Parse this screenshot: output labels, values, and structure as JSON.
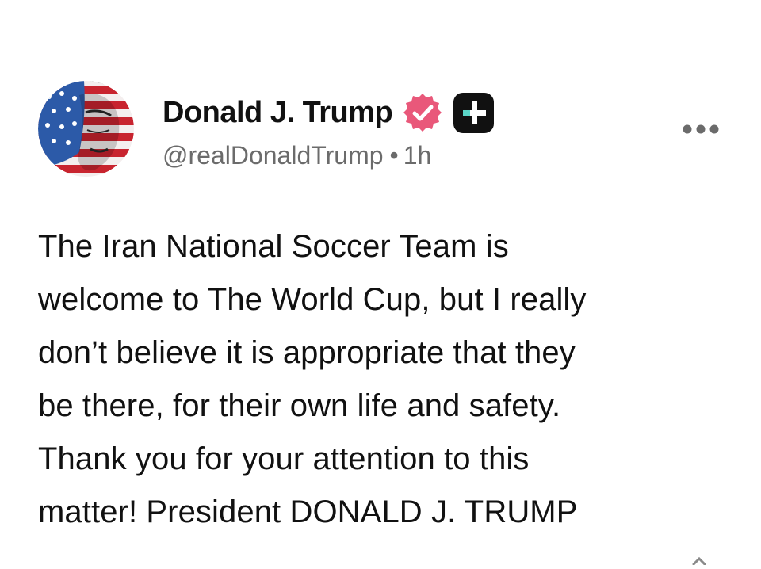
{
  "post": {
    "author": {
      "display_name": "Donald J. Trump",
      "handle": "@realDonaldTrump",
      "verified_icon": "verified-check-badge-icon",
      "plus_icon": "plus-app-badge-icon",
      "avatar_icon": "profile-avatar-flag-portrait"
    },
    "separator": "•",
    "time_ago": "1h",
    "more_icon": "more-horizontal-icon",
    "body": "The Iran National Soccer Team is\nwelcome to The World Cup, but I really\ndon’t believe it is appropriate that they\nbe there, for their own life and safety.\nThank you for your attention to this\nmatter! President DONALD J. TRUMP"
  },
  "colors": {
    "text_primary": "#111111",
    "text_secondary": "#6b6b6b",
    "verified_badge": "#e9587a",
    "plus_badge_bg": "#111111",
    "plus_badge_accent": "#5bd6c8",
    "flag_red": "#c8242f",
    "flag_blue": "#2c5aa8"
  }
}
